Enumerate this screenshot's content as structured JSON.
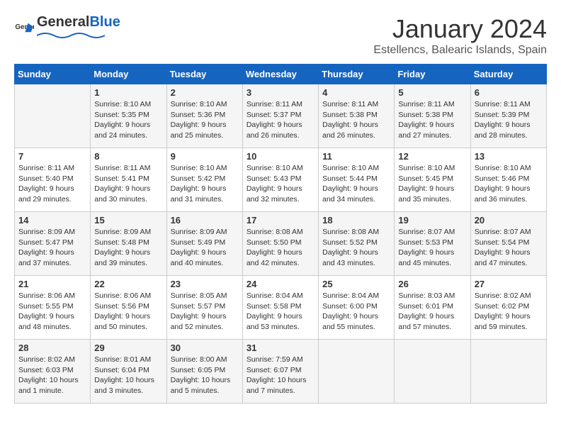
{
  "logo": {
    "general": "General",
    "blue": "Blue"
  },
  "title": "January 2024",
  "location": "Estellencs, Balearic Islands, Spain",
  "weekdays": [
    "Sunday",
    "Monday",
    "Tuesday",
    "Wednesday",
    "Thursday",
    "Friday",
    "Saturday"
  ],
  "weeks": [
    [
      {
        "day": "",
        "sunrise": "",
        "sunset": "",
        "daylight": ""
      },
      {
        "day": "1",
        "sunrise": "Sunrise: 8:10 AM",
        "sunset": "Sunset: 5:35 PM",
        "daylight": "Daylight: 9 hours and 24 minutes."
      },
      {
        "day": "2",
        "sunrise": "Sunrise: 8:10 AM",
        "sunset": "Sunset: 5:36 PM",
        "daylight": "Daylight: 9 hours and 25 minutes."
      },
      {
        "day": "3",
        "sunrise": "Sunrise: 8:11 AM",
        "sunset": "Sunset: 5:37 PM",
        "daylight": "Daylight: 9 hours and 26 minutes."
      },
      {
        "day": "4",
        "sunrise": "Sunrise: 8:11 AM",
        "sunset": "Sunset: 5:38 PM",
        "daylight": "Daylight: 9 hours and 26 minutes."
      },
      {
        "day": "5",
        "sunrise": "Sunrise: 8:11 AM",
        "sunset": "Sunset: 5:38 PM",
        "daylight": "Daylight: 9 hours and 27 minutes."
      },
      {
        "day": "6",
        "sunrise": "Sunrise: 8:11 AM",
        "sunset": "Sunset: 5:39 PM",
        "daylight": "Daylight: 9 hours and 28 minutes."
      }
    ],
    [
      {
        "day": "7",
        "sunrise": "Sunrise: 8:11 AM",
        "sunset": "Sunset: 5:40 PM",
        "daylight": "Daylight: 9 hours and 29 minutes."
      },
      {
        "day": "8",
        "sunrise": "Sunrise: 8:11 AM",
        "sunset": "Sunset: 5:41 PM",
        "daylight": "Daylight: 9 hours and 30 minutes."
      },
      {
        "day": "9",
        "sunrise": "Sunrise: 8:10 AM",
        "sunset": "Sunset: 5:42 PM",
        "daylight": "Daylight: 9 hours and 31 minutes."
      },
      {
        "day": "10",
        "sunrise": "Sunrise: 8:10 AM",
        "sunset": "Sunset: 5:43 PM",
        "daylight": "Daylight: 9 hours and 32 minutes."
      },
      {
        "day": "11",
        "sunrise": "Sunrise: 8:10 AM",
        "sunset": "Sunset: 5:44 PM",
        "daylight": "Daylight: 9 hours and 34 minutes."
      },
      {
        "day": "12",
        "sunrise": "Sunrise: 8:10 AM",
        "sunset": "Sunset: 5:45 PM",
        "daylight": "Daylight: 9 hours and 35 minutes."
      },
      {
        "day": "13",
        "sunrise": "Sunrise: 8:10 AM",
        "sunset": "Sunset: 5:46 PM",
        "daylight": "Daylight: 9 hours and 36 minutes."
      }
    ],
    [
      {
        "day": "14",
        "sunrise": "Sunrise: 8:09 AM",
        "sunset": "Sunset: 5:47 PM",
        "daylight": "Daylight: 9 hours and 37 minutes."
      },
      {
        "day": "15",
        "sunrise": "Sunrise: 8:09 AM",
        "sunset": "Sunset: 5:48 PM",
        "daylight": "Daylight: 9 hours and 39 minutes."
      },
      {
        "day": "16",
        "sunrise": "Sunrise: 8:09 AM",
        "sunset": "Sunset: 5:49 PM",
        "daylight": "Daylight: 9 hours and 40 minutes."
      },
      {
        "day": "17",
        "sunrise": "Sunrise: 8:08 AM",
        "sunset": "Sunset: 5:50 PM",
        "daylight": "Daylight: 9 hours and 42 minutes."
      },
      {
        "day": "18",
        "sunrise": "Sunrise: 8:08 AM",
        "sunset": "Sunset: 5:52 PM",
        "daylight": "Daylight: 9 hours and 43 minutes."
      },
      {
        "day": "19",
        "sunrise": "Sunrise: 8:07 AM",
        "sunset": "Sunset: 5:53 PM",
        "daylight": "Daylight: 9 hours and 45 minutes."
      },
      {
        "day": "20",
        "sunrise": "Sunrise: 8:07 AM",
        "sunset": "Sunset: 5:54 PM",
        "daylight": "Daylight: 9 hours and 47 minutes."
      }
    ],
    [
      {
        "day": "21",
        "sunrise": "Sunrise: 8:06 AM",
        "sunset": "Sunset: 5:55 PM",
        "daylight": "Daylight: 9 hours and 48 minutes."
      },
      {
        "day": "22",
        "sunrise": "Sunrise: 8:06 AM",
        "sunset": "Sunset: 5:56 PM",
        "daylight": "Daylight: 9 hours and 50 minutes."
      },
      {
        "day": "23",
        "sunrise": "Sunrise: 8:05 AM",
        "sunset": "Sunset: 5:57 PM",
        "daylight": "Daylight: 9 hours and 52 minutes."
      },
      {
        "day": "24",
        "sunrise": "Sunrise: 8:04 AM",
        "sunset": "Sunset: 5:58 PM",
        "daylight": "Daylight: 9 hours and 53 minutes."
      },
      {
        "day": "25",
        "sunrise": "Sunrise: 8:04 AM",
        "sunset": "Sunset: 6:00 PM",
        "daylight": "Daylight: 9 hours and 55 minutes."
      },
      {
        "day": "26",
        "sunrise": "Sunrise: 8:03 AM",
        "sunset": "Sunset: 6:01 PM",
        "daylight": "Daylight: 9 hours and 57 minutes."
      },
      {
        "day": "27",
        "sunrise": "Sunrise: 8:02 AM",
        "sunset": "Sunset: 6:02 PM",
        "daylight": "Daylight: 9 hours and 59 minutes."
      }
    ],
    [
      {
        "day": "28",
        "sunrise": "Sunrise: 8:02 AM",
        "sunset": "Sunset: 6:03 PM",
        "daylight": "Daylight: 10 hours and 1 minute."
      },
      {
        "day": "29",
        "sunrise": "Sunrise: 8:01 AM",
        "sunset": "Sunset: 6:04 PM",
        "daylight": "Daylight: 10 hours and 3 minutes."
      },
      {
        "day": "30",
        "sunrise": "Sunrise: 8:00 AM",
        "sunset": "Sunset: 6:05 PM",
        "daylight": "Daylight: 10 hours and 5 minutes."
      },
      {
        "day": "31",
        "sunrise": "Sunrise: 7:59 AM",
        "sunset": "Sunset: 6:07 PM",
        "daylight": "Daylight: 10 hours and 7 minutes."
      },
      {
        "day": "",
        "sunrise": "",
        "sunset": "",
        "daylight": ""
      },
      {
        "day": "",
        "sunrise": "",
        "sunset": "",
        "daylight": ""
      },
      {
        "day": "",
        "sunrise": "",
        "sunset": "",
        "daylight": ""
      }
    ]
  ]
}
